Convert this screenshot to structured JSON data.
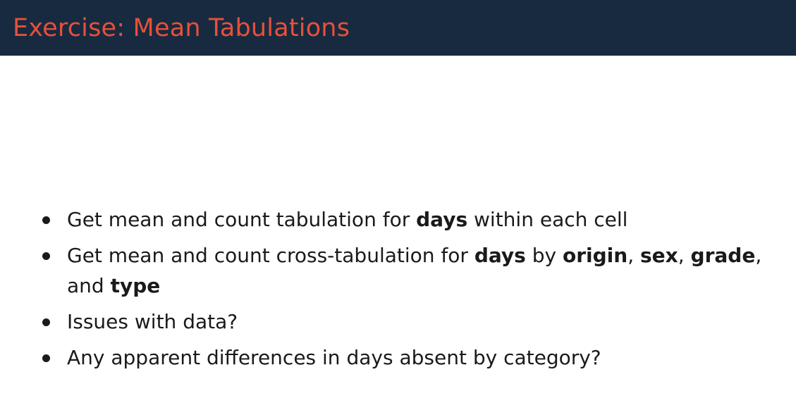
{
  "title": "Exercise: Mean Tabulations",
  "colors": {
    "title_bar": "#172a40",
    "title_text": "#e8503a",
    "body_text": "#1a1a1a"
  },
  "bullets": [
    {
      "parts": [
        {
          "text": "Get mean and count tabulation for ",
          "bold": false
        },
        {
          "text": "days",
          "bold": true
        },
        {
          "text": " within each cell",
          "bold": false
        }
      ]
    },
    {
      "parts": [
        {
          "text": "Get mean and count cross-tabulation for ",
          "bold": false
        },
        {
          "text": "days",
          "bold": true
        },
        {
          "text": " by ",
          "bold": false
        },
        {
          "text": "origin",
          "bold": true
        },
        {
          "text": ", ",
          "bold": false
        },
        {
          "text": "sex",
          "bold": true
        },
        {
          "text": ", ",
          "bold": false
        },
        {
          "text": "grade",
          "bold": true
        },
        {
          "text": ", and ",
          "bold": false
        },
        {
          "text": "type",
          "bold": true
        }
      ]
    },
    {
      "parts": [
        {
          "text": "Issues with data?",
          "bold": false
        }
      ]
    },
    {
      "parts": [
        {
          "text": "Any apparent differences in days absent by category?",
          "bold": false
        }
      ]
    }
  ]
}
